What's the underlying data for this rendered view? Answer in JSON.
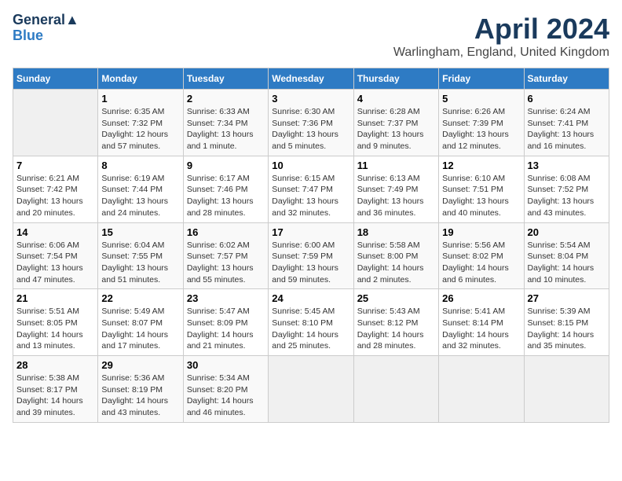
{
  "header": {
    "logo_line1": "General",
    "logo_line2": "Blue",
    "month": "April 2024",
    "location": "Warlingham, England, United Kingdom"
  },
  "columns": [
    "Sunday",
    "Monday",
    "Tuesday",
    "Wednesday",
    "Thursday",
    "Friday",
    "Saturday"
  ],
  "weeks": [
    [
      {
        "day": "",
        "info": ""
      },
      {
        "day": "1",
        "info": "Sunrise: 6:35 AM\nSunset: 7:32 PM\nDaylight: 12 hours\nand 57 minutes."
      },
      {
        "day": "2",
        "info": "Sunrise: 6:33 AM\nSunset: 7:34 PM\nDaylight: 13 hours\nand 1 minute."
      },
      {
        "day": "3",
        "info": "Sunrise: 6:30 AM\nSunset: 7:36 PM\nDaylight: 13 hours\nand 5 minutes."
      },
      {
        "day": "4",
        "info": "Sunrise: 6:28 AM\nSunset: 7:37 PM\nDaylight: 13 hours\nand 9 minutes."
      },
      {
        "day": "5",
        "info": "Sunrise: 6:26 AM\nSunset: 7:39 PM\nDaylight: 13 hours\nand 12 minutes."
      },
      {
        "day": "6",
        "info": "Sunrise: 6:24 AM\nSunset: 7:41 PM\nDaylight: 13 hours\nand 16 minutes."
      }
    ],
    [
      {
        "day": "7",
        "info": "Sunrise: 6:21 AM\nSunset: 7:42 PM\nDaylight: 13 hours\nand 20 minutes."
      },
      {
        "day": "8",
        "info": "Sunrise: 6:19 AM\nSunset: 7:44 PM\nDaylight: 13 hours\nand 24 minutes."
      },
      {
        "day": "9",
        "info": "Sunrise: 6:17 AM\nSunset: 7:46 PM\nDaylight: 13 hours\nand 28 minutes."
      },
      {
        "day": "10",
        "info": "Sunrise: 6:15 AM\nSunset: 7:47 PM\nDaylight: 13 hours\nand 32 minutes."
      },
      {
        "day": "11",
        "info": "Sunrise: 6:13 AM\nSunset: 7:49 PM\nDaylight: 13 hours\nand 36 minutes."
      },
      {
        "day": "12",
        "info": "Sunrise: 6:10 AM\nSunset: 7:51 PM\nDaylight: 13 hours\nand 40 minutes."
      },
      {
        "day": "13",
        "info": "Sunrise: 6:08 AM\nSunset: 7:52 PM\nDaylight: 13 hours\nand 43 minutes."
      }
    ],
    [
      {
        "day": "14",
        "info": "Sunrise: 6:06 AM\nSunset: 7:54 PM\nDaylight: 13 hours\nand 47 minutes."
      },
      {
        "day": "15",
        "info": "Sunrise: 6:04 AM\nSunset: 7:55 PM\nDaylight: 13 hours\nand 51 minutes."
      },
      {
        "day": "16",
        "info": "Sunrise: 6:02 AM\nSunset: 7:57 PM\nDaylight: 13 hours\nand 55 minutes."
      },
      {
        "day": "17",
        "info": "Sunrise: 6:00 AM\nSunset: 7:59 PM\nDaylight: 13 hours\nand 59 minutes."
      },
      {
        "day": "18",
        "info": "Sunrise: 5:58 AM\nSunset: 8:00 PM\nDaylight: 14 hours\nand 2 minutes."
      },
      {
        "day": "19",
        "info": "Sunrise: 5:56 AM\nSunset: 8:02 PM\nDaylight: 14 hours\nand 6 minutes."
      },
      {
        "day": "20",
        "info": "Sunrise: 5:54 AM\nSunset: 8:04 PM\nDaylight: 14 hours\nand 10 minutes."
      }
    ],
    [
      {
        "day": "21",
        "info": "Sunrise: 5:51 AM\nSunset: 8:05 PM\nDaylight: 14 hours\nand 13 minutes."
      },
      {
        "day": "22",
        "info": "Sunrise: 5:49 AM\nSunset: 8:07 PM\nDaylight: 14 hours\nand 17 minutes."
      },
      {
        "day": "23",
        "info": "Sunrise: 5:47 AM\nSunset: 8:09 PM\nDaylight: 14 hours\nand 21 minutes."
      },
      {
        "day": "24",
        "info": "Sunrise: 5:45 AM\nSunset: 8:10 PM\nDaylight: 14 hours\nand 25 minutes."
      },
      {
        "day": "25",
        "info": "Sunrise: 5:43 AM\nSunset: 8:12 PM\nDaylight: 14 hours\nand 28 minutes."
      },
      {
        "day": "26",
        "info": "Sunrise: 5:41 AM\nSunset: 8:14 PM\nDaylight: 14 hours\nand 32 minutes."
      },
      {
        "day": "27",
        "info": "Sunrise: 5:39 AM\nSunset: 8:15 PM\nDaylight: 14 hours\nand 35 minutes."
      }
    ],
    [
      {
        "day": "28",
        "info": "Sunrise: 5:38 AM\nSunset: 8:17 PM\nDaylight: 14 hours\nand 39 minutes."
      },
      {
        "day": "29",
        "info": "Sunrise: 5:36 AM\nSunset: 8:19 PM\nDaylight: 14 hours\nand 43 minutes."
      },
      {
        "day": "30",
        "info": "Sunrise: 5:34 AM\nSunset: 8:20 PM\nDaylight: 14 hours\nand 46 minutes."
      },
      {
        "day": "",
        "info": ""
      },
      {
        "day": "",
        "info": ""
      },
      {
        "day": "",
        "info": ""
      },
      {
        "day": "",
        "info": ""
      }
    ]
  ]
}
